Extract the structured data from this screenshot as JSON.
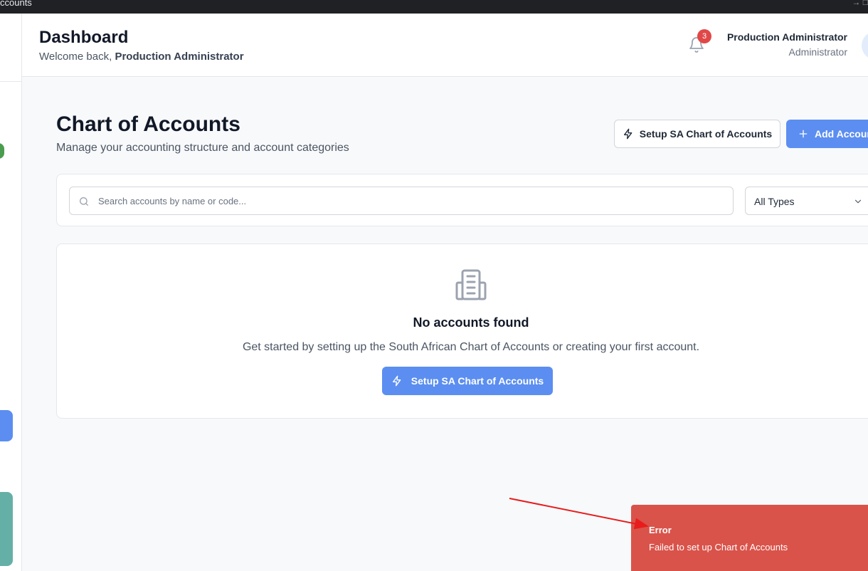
{
  "browser": {
    "tab_title": "ccounts",
    "icons": "→  □"
  },
  "header": {
    "title": "Dashboard",
    "welcome_prefix": "Welcome back,",
    "welcome_name": "Production Administrator",
    "notification_count": "3",
    "user_name": "Production Administrator",
    "user_role": "Administrator"
  },
  "page": {
    "title": "Chart of Accounts",
    "subtitle": "Manage your accounting structure and account categories",
    "setup_button": "Setup SA Chart of Accounts",
    "add_button": "Add Account"
  },
  "filters": {
    "search_placeholder": "Search accounts by name or code...",
    "search_value": "",
    "type_select": "All Types"
  },
  "empty_state": {
    "title": "No accounts found",
    "message": "Get started by setting up the South African Chart of Accounts or creating your first account.",
    "button": "Setup SA Chart of Accounts"
  },
  "toast": {
    "title": "Error",
    "message": "Failed to set up Chart of Accounts"
  },
  "colors": {
    "primary": "#5b8ef0",
    "error": "#d9534a",
    "badge": "#e04848",
    "annotation_arrow": "#e81c1c"
  }
}
